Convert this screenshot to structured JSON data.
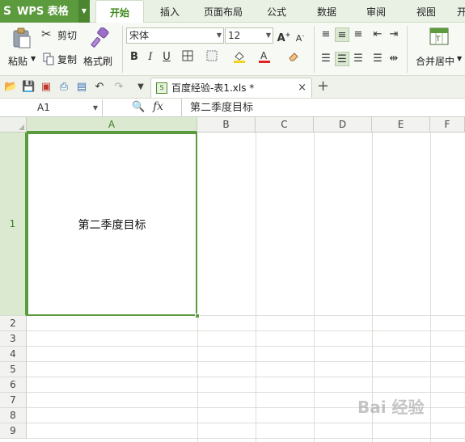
{
  "app": {
    "brand_label": "WPS 表格",
    "tabs": [
      {
        "label": "开始",
        "active": true
      },
      {
        "label": "插入",
        "active": false
      },
      {
        "label": "页面布局",
        "active": false
      },
      {
        "label": "公式",
        "active": false
      },
      {
        "label": "数据",
        "active": false
      },
      {
        "label": "审阅",
        "active": false
      },
      {
        "label": "视图",
        "active": false
      },
      {
        "label": "开",
        "active": false
      }
    ]
  },
  "ribbon": {
    "paste_label": "粘贴",
    "cut_label": "剪切",
    "copy_label": "复制",
    "format_painter_label": "格式刷",
    "font_name": "宋体",
    "font_size": "12",
    "merge_center_label": "合并居中"
  },
  "doc": {
    "tab_label": "百度经验-表1.xls *",
    "close_glyph": "×",
    "new_tab_glyph": "+"
  },
  "formula_bar": {
    "name_box": "A1",
    "fx_label": "fx",
    "content": "第二季度目标"
  },
  "sheet": {
    "columns": [
      "A",
      "B",
      "C",
      "D",
      "E",
      "F"
    ],
    "rows": [
      "1",
      "2",
      "3",
      "4",
      "5",
      "6",
      "7",
      "8",
      "9"
    ],
    "selected_cell": "A1",
    "cells": {
      "A1": "第二季度目标"
    }
  },
  "colors": {
    "brand_green": "#5b9a3d",
    "selection_green": "#5b9a3d",
    "header_selected_bg": "#dbe9d0"
  },
  "watermark": "Bai 经验"
}
